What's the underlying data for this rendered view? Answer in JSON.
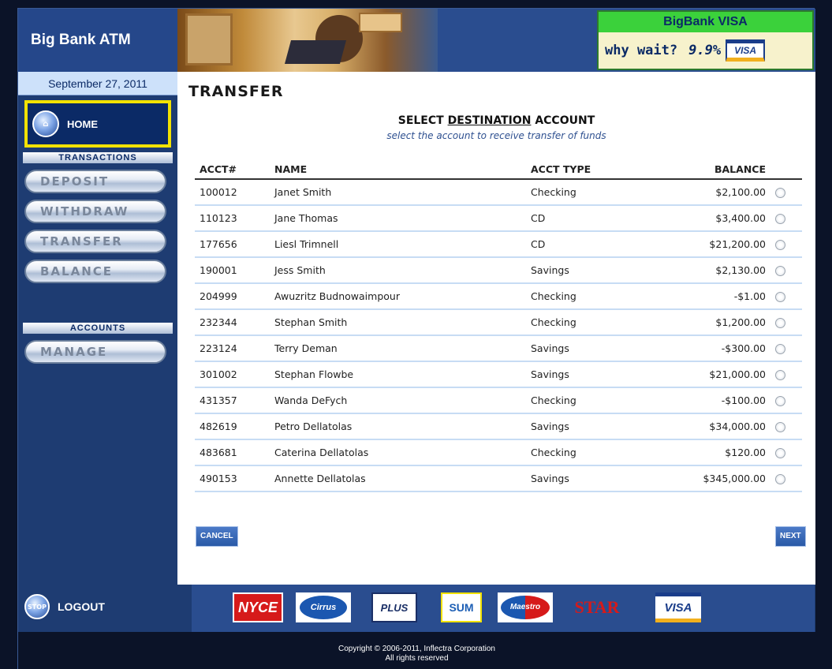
{
  "app": {
    "title": "Big Bank ATM",
    "date": "September 27, 2011"
  },
  "ad": {
    "title": "BigBank VISA",
    "tagline": "why wait?",
    "rate": "9.9%",
    "card_label": "VISA"
  },
  "sidebar": {
    "home_label": "HOME",
    "transactions_heading": "TRANSACTIONS",
    "transactions": [
      {
        "label": "DEPOSIT"
      },
      {
        "label": "WITHDRAW"
      },
      {
        "label": "TRANSFER"
      },
      {
        "label": "BALANCE"
      }
    ],
    "accounts_heading": "ACCOUNTS",
    "accounts": [
      {
        "label": "MANAGE"
      }
    ],
    "logout_label": "LOGOUT"
  },
  "main": {
    "page_title": "TRANSFER",
    "subtitle_prefix": "SELECT ",
    "subtitle_emphasis": "DESTINATION",
    "subtitle_suffix": " ACCOUNT",
    "instruction": "select the account to receive transfer of funds",
    "columns": {
      "acct": "ACCT#",
      "name": "NAME",
      "type": "ACCT TYPE",
      "balance": "BALANCE"
    },
    "rows": [
      {
        "acct": "100012",
        "name": "Janet Smith",
        "type": "Checking",
        "balance": "$2,100.00"
      },
      {
        "acct": "110123",
        "name": "Jane Thomas",
        "type": "CD",
        "balance": "$3,400.00"
      },
      {
        "acct": "177656",
        "name": "Liesl Trimnell",
        "type": "CD",
        "balance": "$21,200.00"
      },
      {
        "acct": "190001",
        "name": "Jess Smith",
        "type": "Savings",
        "balance": "$2,130.00"
      },
      {
        "acct": "204999",
        "name": "Awuzritz Budnowaimpour",
        "type": "Checking",
        "balance": "-$1.00"
      },
      {
        "acct": "232344",
        "name": "Stephan Smith",
        "type": "Checking",
        "balance": "$1,200.00"
      },
      {
        "acct": "223124",
        "name": "Terry Deman",
        "type": "Savings",
        "balance": "-$300.00"
      },
      {
        "acct": "301002",
        "name": "Stephan Flowbe",
        "type": "Savings",
        "balance": "$21,000.00"
      },
      {
        "acct": "431357",
        "name": "Wanda DeFych",
        "type": "Checking",
        "balance": "-$100.00"
      },
      {
        "acct": "482619",
        "name": "Petro Dellatolas",
        "type": "Savings",
        "balance": "$34,000.00"
      },
      {
        "acct": "483681",
        "name": "Caterina Dellatolas",
        "type": "Checking",
        "balance": "$120.00"
      },
      {
        "acct": "490153",
        "name": "Annette Dellatolas",
        "type": "Savings",
        "balance": "$345,000.00"
      }
    ],
    "cancel_label": "CANCEL",
    "next_label": "NEXT"
  },
  "footer": {
    "logos": {
      "nyce": "NYCE",
      "cirrus": "Cirrus",
      "plus": "PLUS",
      "sum": "SUM",
      "maestro": "Maestro",
      "star": "STAR",
      "visa": "VISA"
    },
    "copyright": "Copyright © 2006-2011, Inflectra Corporation",
    "rights": "All rights reserved"
  },
  "colors": {
    "highlight": "#f2e200",
    "nav_bg": "#1e3c72",
    "ad_green": "#3bd13b"
  },
  "icons": {
    "home": "home-icon",
    "logout": "stop-icon"
  }
}
